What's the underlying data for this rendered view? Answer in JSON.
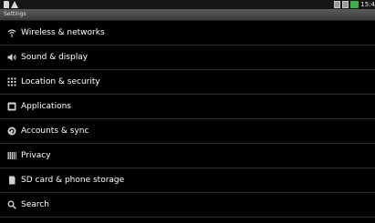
{
  "status_bar": {
    "time": "15:4",
    "left_icons": [
      "sd-card-icon",
      "warning-icon"
    ],
    "right_icons": [
      "notification-icon",
      "signal-icon",
      "battery-icon"
    ]
  },
  "header": {
    "title": "Settings"
  },
  "settings": {
    "items": [
      {
        "label": "Wireless & networks",
        "icon": "wifi-icon"
      },
      {
        "label": "Sound & display",
        "icon": "speaker-icon"
      },
      {
        "label": "Location & security",
        "icon": "grid-icon"
      },
      {
        "label": "Applications",
        "icon": "applications-icon"
      },
      {
        "label": "Accounts & sync",
        "icon": "sync-icon"
      },
      {
        "label": "Privacy",
        "icon": "privacy-icon"
      },
      {
        "label": "SD card & phone storage",
        "icon": "sd-card-icon"
      },
      {
        "label": "Search",
        "icon": "search-icon"
      }
    ]
  },
  "colors": {
    "background": "#000000",
    "text": "#ffffff",
    "status_green": "#39b54a"
  }
}
